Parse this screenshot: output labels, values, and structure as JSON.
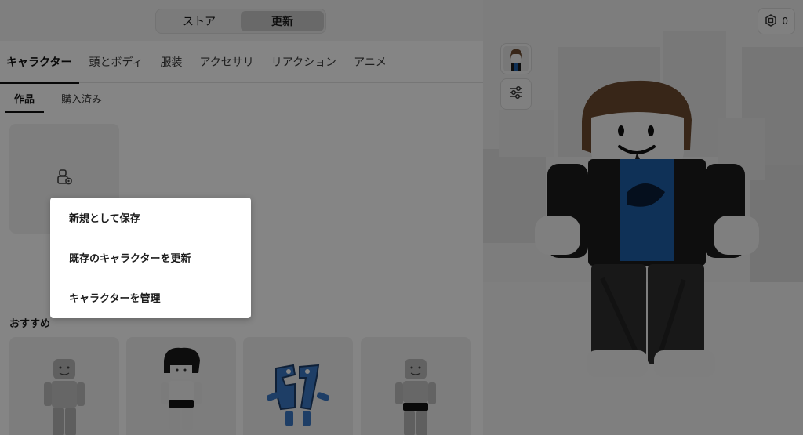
{
  "header": {
    "segments": [
      {
        "label": "ストア",
        "active": false
      },
      {
        "label": "更新",
        "active": true
      }
    ]
  },
  "tabs": [
    {
      "label": "キャラクター",
      "active": true
    },
    {
      "label": "頭とボディ",
      "active": false
    },
    {
      "label": "服装",
      "active": false
    },
    {
      "label": "アクセサリ",
      "active": false
    },
    {
      "label": "リアクション",
      "active": false
    },
    {
      "label": "アニメ",
      "active": false
    }
  ],
  "subtabs": [
    {
      "label": "作品",
      "active": true
    },
    {
      "label": "購入済み",
      "active": false
    }
  ],
  "create_card": {
    "icon": "create-character-icon"
  },
  "recommended": {
    "title": "おすすめ",
    "items": [
      {
        "name": "plain-gray-avatar"
      },
      {
        "name": "black-hair-avatar"
      },
      {
        "name": "blue-67-avatar"
      },
      {
        "name": "gray-avatar-black-shorts"
      }
    ]
  },
  "viewport": {
    "robux_amount": "0",
    "buttons": [
      "avatar-thumbnail",
      "adjust-sliders-icon"
    ]
  },
  "context_menu": {
    "items": [
      {
        "label": "新規として保存"
      },
      {
        "label": "既存のキャラクターを更新"
      },
      {
        "label": "キャラクターを管理"
      }
    ]
  },
  "colors": {
    "overlay": "#000000",
    "shirt_blue": "#1d5fa8",
    "jacket": "#1b1b1b",
    "hair": "#6b4a2f"
  }
}
